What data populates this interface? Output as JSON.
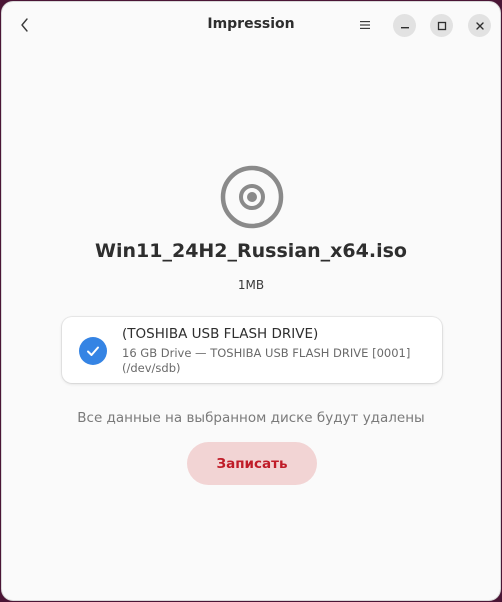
{
  "window": {
    "title": "Impression"
  },
  "header": {
    "back_icon": "chevron-left-icon",
    "menu_icon": "hamburger-menu-icon",
    "controls": {
      "minimize_icon": "minimize-icon",
      "maximize_icon": "maximize-icon",
      "close_icon": "close-icon"
    }
  },
  "file": {
    "icon": "disc-icon",
    "name": "Win11_24H2_Russian_x64.iso",
    "size": "1MB"
  },
  "drive": {
    "selected": true,
    "name": "(TOSHIBA USB FLASH DRIVE)",
    "description": "16 GB Drive — TOSHIBA USB FLASH DRIVE [0001] (/dev/sdb)"
  },
  "warning_text": "Все данные на выбранном диске будут удалены",
  "write_button_label": "Записать",
  "colors": {
    "accent": "#3584e4",
    "destructive": "#c01c28",
    "destructive_bg": "#f2d4d4",
    "window_bg": "#fafafa"
  }
}
